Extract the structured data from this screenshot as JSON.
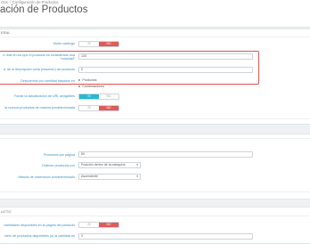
{
  "breadcrumb": {
    "parent": "ctos",
    "separator": "/",
    "current": "Configuración de Productos"
  },
  "page": {
    "title": "ación de Productos"
  },
  "section1": {
    "heading": "ERAL",
    "catalog_mode": {
      "label": "Modo catálogo",
      "off": "SÍ",
      "on": "NO"
    },
    "new_days": {
      "label_line1": "e días en los que el producto es considerado una",
      "label_line2": "\"novedad\"",
      "value": "130"
    },
    "summary_max": {
      "label": "d. de la descripción corta (resumen) del producto",
      "value": "0"
    },
    "quantity_discounts": {
      "label": "Descuentos por cantidad basados en",
      "option1": "Productos",
      "option2": "Combinaciones"
    },
    "friendly_url": {
      "label": "Forzar la actualización de URL amigables",
      "on": "SÍ",
      "off": "NO"
    },
    "new_default_state": {
      "label": "ar nuevos productos de manera predeterminada",
      "off": "SÍ",
      "on": "NO"
    }
  },
  "section2": {
    "per_page": {
      "label": "Productos por página",
      "value": "50"
    },
    "order_by": {
      "label": "Ordenar productos por",
      "value": "Posición dentro de la categoría"
    },
    "order_method": {
      "label": "Método de ordenación predeterminado",
      "value": "Ascendente"
    }
  },
  "section3": {
    "heading": "UCTO",
    "show_qty": {
      "label": "cantidades disponibles en la página del producto",
      "off": "SÍ",
      "on": "NO"
    },
    "low_stock": {
      "label": "mero de productos disponibles (s) la cantidad es",
      "value": "3"
    }
  },
  "colors": {
    "link": "#3a8fc4",
    "active_red": "#e05a5a",
    "active_blue": "#25b9d7",
    "highlight": "#d9534f"
  }
}
